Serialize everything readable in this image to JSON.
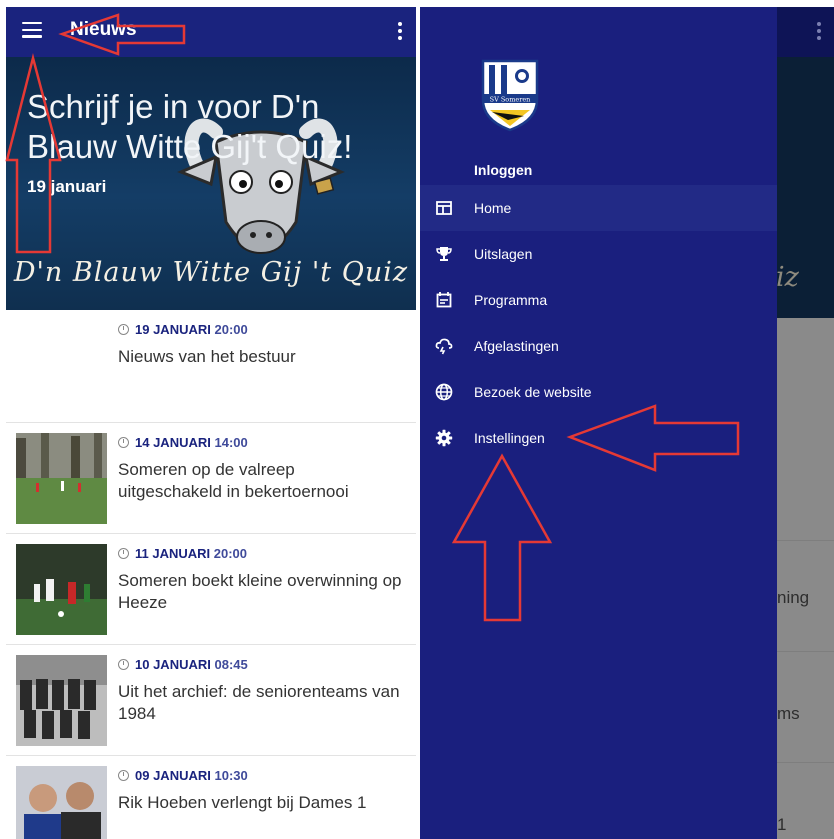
{
  "left_app": {
    "appbar": {
      "title": "Nieuws",
      "menu_icon": "hamburger-icon",
      "overflow_icon": "kebab-icon"
    },
    "hero": {
      "title": "Schrijf je in voor D'n Blauw Witte Gij't Quiz!",
      "date": "19 januari",
      "brand_text": "D'n Blauw Witte Gij 't Quiz"
    },
    "news": [
      {
        "date": "19 JANUARI",
        "time": "20:00",
        "title": "Nieuws van het bestuur"
      },
      {
        "date": "14 JANUARI",
        "time": "14:00",
        "title": "Someren op de valreep uitgeschakeld in bekertoernooi"
      },
      {
        "date": "11 JANUARI",
        "time": "20:00",
        "title": "Someren boekt kleine overwinning op Heeze"
      },
      {
        "date": "10 JANUARI",
        "time": "08:45",
        "title": "Uit het archief: de seniorenteams van 1984"
      },
      {
        "date": "09 JANUARI",
        "time": "10:30",
        "title": "Rik Hoeben verlengt bij Dames 1"
      }
    ]
  },
  "right_app": {
    "drawer": {
      "logo_text": "SV Someren",
      "login_label": "Inloggen",
      "items": [
        {
          "label": "Home",
          "icon": "home-icon"
        },
        {
          "label": "Uitslagen",
          "icon": "trophy-icon"
        },
        {
          "label": "Programma",
          "icon": "calendar-icon"
        },
        {
          "label": "Afgelastingen",
          "icon": "cloud-rain-icon"
        },
        {
          "label": "Bezoek de website",
          "icon": "globe-icon"
        },
        {
          "label": "Instellingen",
          "icon": "gear-icon"
        }
      ]
    },
    "background_snippets": {
      "hero_tail": "iz",
      "item1": "ning",
      "item2": "ms",
      "item3": "1"
    }
  },
  "colors": {
    "appbar": "#1a237e",
    "drawer": "#1a1f7e",
    "annotation_arrow": "#e53935",
    "accent_text": "#1a237e"
  }
}
